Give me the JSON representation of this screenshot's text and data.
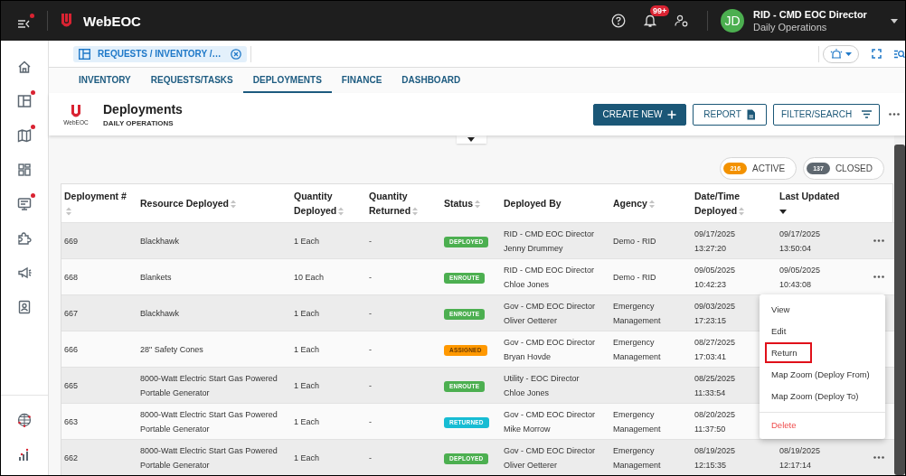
{
  "app": {
    "title": "WebEOC",
    "menu_alert": true,
    "notifications_badge": "99+",
    "user": {
      "initials": "JD",
      "name": "RID - CMD EOC Director",
      "position": "Daily Operations"
    }
  },
  "sidebar": {
    "items": [
      {
        "kind": "home",
        "alert": false
      },
      {
        "kind": "layout",
        "alert": true
      },
      {
        "kind": "map",
        "alert": true
      },
      {
        "kind": "grid",
        "alert": false
      },
      {
        "kind": "monitor",
        "alert": true
      },
      {
        "kind": "puzzle",
        "alert": false
      },
      {
        "kind": "megaphone",
        "alert": false
      },
      {
        "kind": "badge",
        "alert": false
      }
    ],
    "footer_items": [
      {
        "kind": "globe"
      },
      {
        "kind": "chart"
      }
    ]
  },
  "open_board": {
    "label": "REQUESTS / INVENTORY /…"
  },
  "tabs": [
    {
      "label": "INVENTORY",
      "selected": false
    },
    {
      "label": "REQUESTS/TASKS",
      "selected": false
    },
    {
      "label": "DEPLOYMENTS",
      "selected": true
    },
    {
      "label": "FINANCE",
      "selected": false
    },
    {
      "label": "DASHBOARD",
      "selected": false
    }
  ],
  "page_header": {
    "title": "Deployments",
    "subtitle": "DAILY OPERATIONS",
    "logo_caption": "WebEOC",
    "buttons": [
      {
        "label": "CREATE NEW",
        "kind": "create"
      },
      {
        "label": "REPORT",
        "kind": "report"
      },
      {
        "label": "FILTER/SEARCH",
        "kind": "filter"
      }
    ]
  },
  "counters": [
    {
      "count": "216",
      "label": "ACTIVE",
      "color": "#f39200"
    },
    {
      "count": "137",
      "label": "CLOSED",
      "color": "#5f6870"
    }
  ],
  "table": {
    "columns": [
      {
        "label": "Deployment #",
        "sortable": true
      },
      {
        "label": "Resource Deployed",
        "sortable": true
      },
      {
        "label": "Quantity Deployed",
        "sortable": true
      },
      {
        "label": "Quantity Returned",
        "sortable": true
      },
      {
        "label": "Status",
        "sortable": true
      },
      {
        "label": "Deployed By",
        "sortable": false
      },
      {
        "label": "Agency",
        "sortable": true
      },
      {
        "label": "Date/Time Deployed",
        "sortable": true
      },
      {
        "label": "Last Updated",
        "sortable": true,
        "sorted_descending": true
      }
    ],
    "rows": [
      {
        "id": "669",
        "resource": "Blackhawk",
        "qty_deployed": "1 Each",
        "qty_returned": "-",
        "status": {
          "label": "DEPLOYED",
          "kind": "deployed"
        },
        "deployed_by": "RID - CMD EOC Director\nJenny Drummey",
        "agency": "Demo - RID",
        "date_deployed": "09/17/2025\n13:27:20",
        "last_updated": "09/17/2025\n13:50:04",
        "more_button": true
      },
      {
        "id": "668",
        "resource": "Blankets",
        "qty_deployed": "10 Each",
        "qty_returned": "-",
        "status": {
          "label": "ENROUTE",
          "kind": "enroute"
        },
        "deployed_by": "RID - CMD EOC Director\nChloe Jones",
        "agency": "Demo - RID",
        "date_deployed": "09/05/2025\n10:42:23",
        "last_updated": "09/05/2025\n10:43:08",
        "more_button": true
      },
      {
        "id": "667",
        "resource": "Blackhawk",
        "qty_deployed": "1 Each",
        "qty_returned": "-",
        "status": {
          "label": "ENROUTE",
          "kind": "enroute"
        },
        "deployed_by": "Gov - CMD EOC Director\nOliver Oetterer",
        "agency": "Emergency\nManagement",
        "date_deployed": "09/03/2025\n17:23:15",
        "more_button": false
      },
      {
        "id": "666",
        "resource": "28\" Safety Cones",
        "qty_deployed": "1 Each",
        "qty_returned": "-",
        "status": {
          "label": "ASSIGNED",
          "kind": "assigned"
        },
        "deployed_by": "Gov - CMD EOC Director\nBryan Hovde",
        "agency": "Emergency\nManagement",
        "date_deployed": "08/27/2025\n17:03:41",
        "more_button": false
      },
      {
        "id": "665",
        "resource": "8000-Watt Electric Start Gas Powered\nPortable Generator",
        "qty_deployed": "1 Each",
        "qty_returned": "-",
        "status": {
          "label": "ENROUTE",
          "kind": "enroute"
        },
        "deployed_by": "Utility - EOC Director\nChloe Jones",
        "date_deployed": "08/25/2025\n11:33:54",
        "more_button": false
      },
      {
        "id": "663",
        "resource": "8000-Watt Electric Start Gas Powered\nPortable Generator",
        "qty_deployed": "1 Each",
        "qty_returned": "-",
        "status": {
          "label": "RETURNED",
          "kind": "returned"
        },
        "deployed_by": "Gov - CMD EOC Director\nMike Morrow",
        "agency": "Emergency\nManagement",
        "date_deployed": "08/20/2025\n11:37:50",
        "more_button": false
      },
      {
        "id": "662",
        "resource": "8000-Watt Electric Start Gas Powered\nPortable Generator",
        "qty_deployed": "1 Each",
        "qty_returned": "-",
        "status": {
          "label": "DEPLOYED",
          "kind": "deployed"
        },
        "deployed_by": "Gov - CMD EOC Director\nOliver Oetterer",
        "agency": "Emergency\nManagement",
        "date_deployed": "08/19/2025\n12:15:35",
        "last_updated": "08/19/2025\n12:17:14",
        "more_button": true
      }
    ]
  },
  "row_menu": {
    "items": [
      {
        "label": "View",
        "kind": "item",
        "highlighted": false
      },
      {
        "label": "Edit",
        "kind": "item",
        "highlighted": false
      },
      {
        "label": "Return",
        "kind": "item",
        "highlighted": true
      },
      {
        "label": "Map Zoom (Deploy From)",
        "kind": "item",
        "highlighted": false
      },
      {
        "label": "Map Zoom (Deploy To)",
        "kind": "item",
        "highlighted": false
      },
      {
        "label": "Delete",
        "kind": "danger",
        "highlighted": false
      }
    ]
  }
}
